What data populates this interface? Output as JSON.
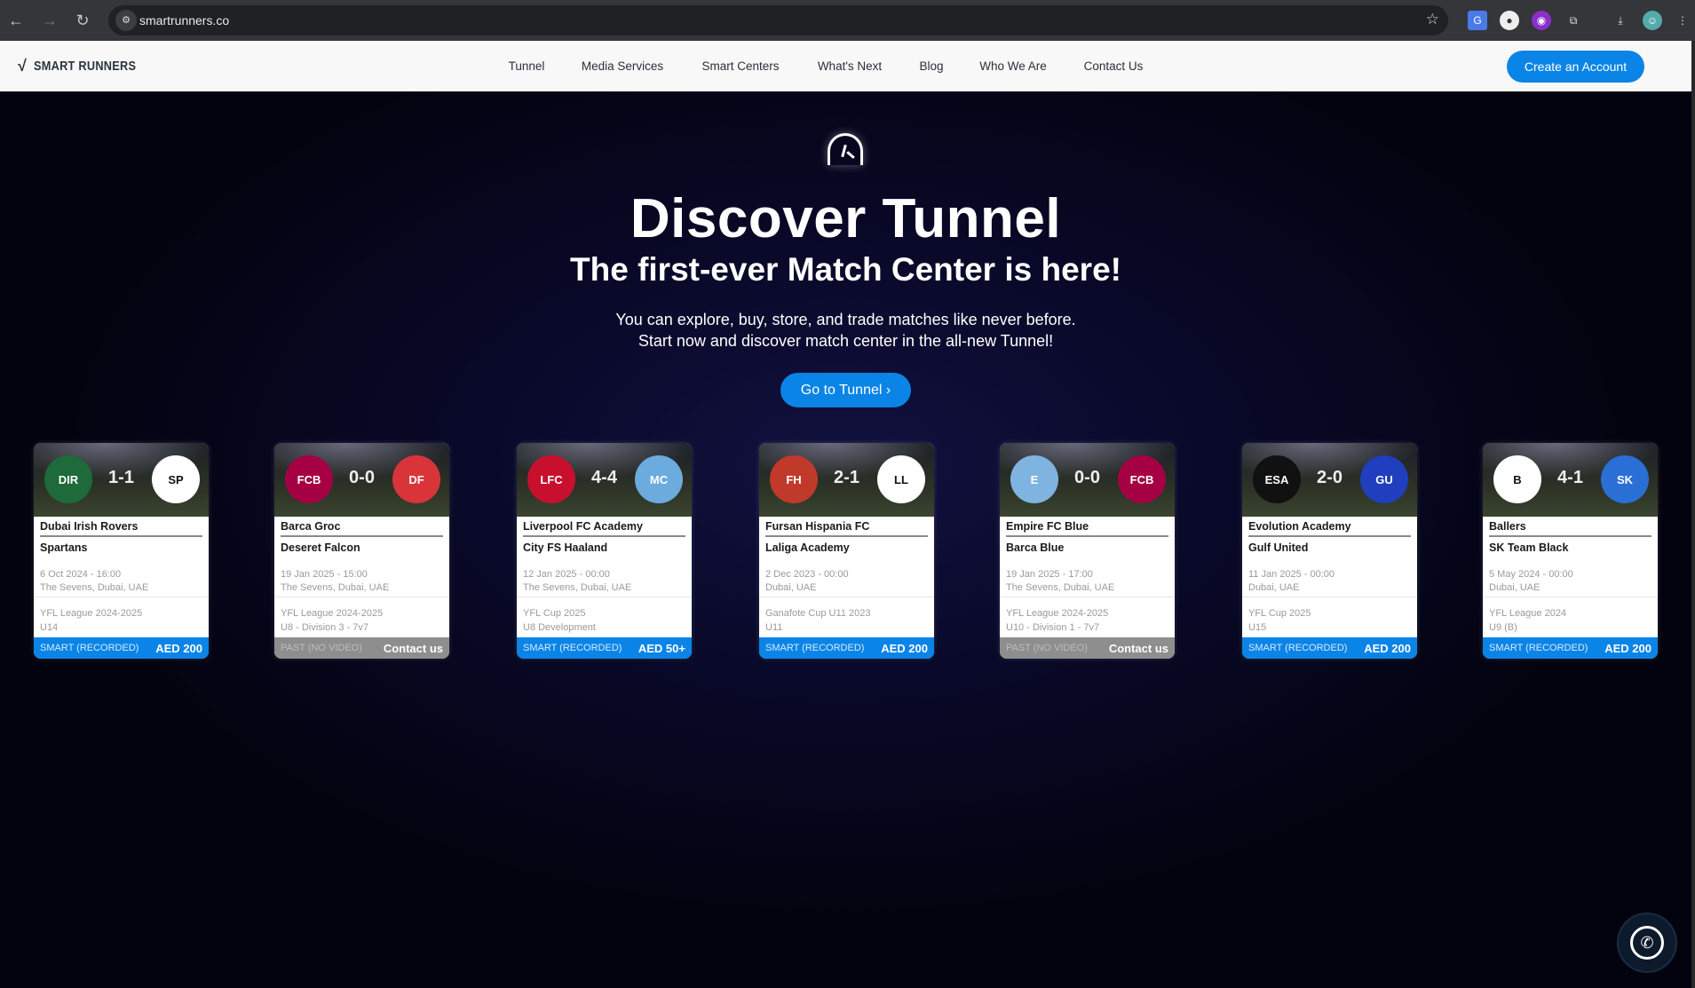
{
  "browser": {
    "url": "smartrunners.co"
  },
  "nav": {
    "brand": "SMART RUNNERS",
    "items": [
      "Tunnel",
      "Media Services",
      "Smart Centers",
      "What's Next",
      "Blog",
      "Who We Are",
      "Contact Us"
    ],
    "cta": "Create an Account"
  },
  "hero": {
    "title": "Discover Tunnel",
    "subtitle": "The first-ever Match Center is here!",
    "line1": "You can explore, buy, store, and trade matches like never before.",
    "line2": "Start now and discover match center in the all-new Tunnel!",
    "button": "Go to Tunnel"
  },
  "colors": {
    "accent": "#0a84e6",
    "past": "#8e8e8e"
  },
  "matches": [
    {
      "home": "Dubai Irish Rovers",
      "away": "Spartans",
      "score": "1-1",
      "date": "6 Oct 2024 - 16:00",
      "venue": "The Sevens, Dubai, UAE",
      "league": "YFL League 2024-2025",
      "group": "U14",
      "status": "SMART (RECORDED)",
      "price": "AED 200",
      "type": "smart",
      "hb": [
        "#1e6a3a",
        "DIR"
      ],
      "ab": [
        "#ffffff",
        "SP"
      ]
    },
    {
      "home": "Barca Groc",
      "away": "Deseret Falcon",
      "score": "0-0",
      "date": "19 Jan 2025 - 15:00",
      "venue": "The Sevens, Dubai, UAE",
      "league": "YFL League 2024-2025",
      "group": "U8 - Division 3 - 7v7",
      "status": "PAST (NO VIDEO)",
      "price": "Contact us",
      "type": "past",
      "hb": [
        "#a50044",
        "FCB"
      ],
      "ab": [
        "#d9343a",
        "DF"
      ]
    },
    {
      "home": "Liverpool FC Academy",
      "away": "City FS Haaland",
      "score": "4-4",
      "date": "12 Jan 2025 - 00:00",
      "venue": "The Sevens, Dubai, UAE",
      "league": "YFL Cup 2025",
      "group": "U8 Development",
      "status": "SMART (RECORDED)",
      "price": "AED 50+",
      "type": "smart",
      "hb": [
        "#c8102e",
        "LFC"
      ],
      "ab": [
        "#6cabdd",
        "MC"
      ]
    },
    {
      "home": "Fursan Hispania FC",
      "away": "Laliga Academy",
      "score": "2-1",
      "date": "2 Dec 2023 - 00:00",
      "venue": "Dubai, UAE",
      "league": "Ganafote Cup U11 2023",
      "group": "U11",
      "status": "SMART (RECORDED)",
      "price": "AED 200",
      "type": "smart",
      "hb": [
        "#c0392b",
        "FH"
      ],
      "ab": [
        "#ffffff",
        "LL"
      ]
    },
    {
      "home": "Empire FC Blue",
      "away": "Barca Blue",
      "score": "0-0",
      "date": "19 Jan 2025 - 17:00",
      "venue": "The Sevens, Dubai, UAE",
      "league": "YFL League 2024-2025",
      "group": "U10 - Division 1 - 7v7",
      "status": "PAST (NO VIDEO)",
      "price": "Contact us",
      "type": "past",
      "hb": [
        "#7fb3e0",
        "E"
      ],
      "ab": [
        "#a50044",
        "FCB"
      ]
    },
    {
      "home": "Evolution Academy",
      "away": "Gulf United",
      "score": "2-0",
      "date": "11 Jan 2025 - 00:00",
      "venue": "Dubai, UAE",
      "league": "YFL Cup 2025",
      "group": "U15",
      "status": "SMART (RECORDED)",
      "price": "AED 200",
      "type": "smart",
      "hb": [
        "#111111",
        "ESA"
      ],
      "ab": [
        "#1f3fbf",
        "GU"
      ]
    },
    {
      "home": "Ballers",
      "away": "SK Team Black",
      "score": "4-1",
      "date": "5 May 2024 - 00:00",
      "venue": "Dubai, UAE",
      "league": "YFL League 2024",
      "group": "U9 (B)",
      "status": "SMART (RECORDED)",
      "price": "AED 200",
      "type": "smart",
      "hb": [
        "#ffffff",
        "B"
      ],
      "ab": [
        "#2a6fd6",
        "SK"
      ]
    }
  ]
}
